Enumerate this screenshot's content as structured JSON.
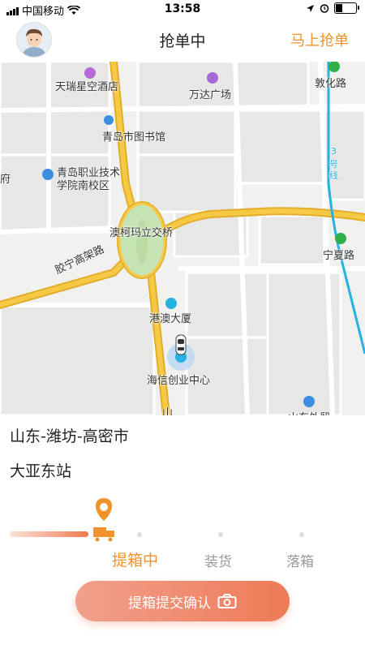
{
  "status_bar": {
    "carrier": "中国移动",
    "time": "13:58"
  },
  "header": {
    "title": "抢单中",
    "action": "马上抢单"
  },
  "map": {
    "labels": [
      "天瑞星空酒店",
      "万达广场",
      "敦化路",
      "青岛市图书馆",
      "青岛职业技术",
      "学院南校区",
      "澳柯玛立交桥",
      "宁夏路",
      "胶宁高架路",
      "港澳大厦",
      "海信创业中心",
      "3",
      "号",
      "线",
      "山",
      "山东外贸",
      "府"
    ],
    "road_color": "#f6c945",
    "metro_color": "#27b1e0"
  },
  "address": {
    "region": "山东-潍坊-高密市",
    "station": "大亚东站"
  },
  "progress": {
    "steps": [
      "提箱中",
      "装货",
      "落箱"
    ],
    "active_index": 0,
    "active_color": "#f0932b",
    "inactive_color": "#999999"
  },
  "cta": {
    "label": "提箱提交确认",
    "icon": "camera-icon"
  }
}
